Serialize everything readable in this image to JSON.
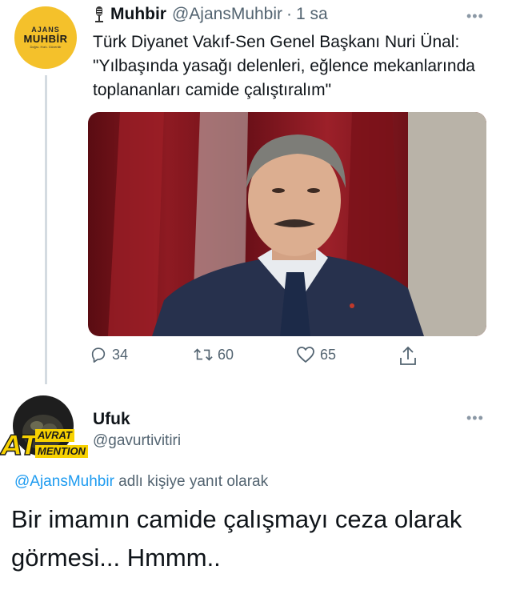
{
  "tweet1": {
    "avatar_text": {
      "line1": "AJANS",
      "line2": "MUHBİR",
      "line3": "Doğru. Hızlı. Güvenilir"
    },
    "author_name": "Muhbir",
    "handle": "@AjansMuhbir",
    "separator": "·",
    "time": "1 sa",
    "text": "Türk Diyanet Vakıf-Sen Genel Başkanı Nuri Ünal: \"Yılbaşında yasağı delenleri, eğlence mekanlarında toplananları camide çalıştıralım\"",
    "more_glyph": "•••",
    "actions": {
      "replies": "34",
      "retweets": "60",
      "likes": "65"
    }
  },
  "tweet2": {
    "avatar_text": {
      "line1": "AT",
      "line2": "AVRAT",
      "line3": "MENTION"
    },
    "author_name": "Ufuk",
    "handle": "@gavurtivitiri",
    "more_glyph": "•••",
    "reply_to_handle": "@AjansMuhbir",
    "reply_suffix": " adlı kişiye yanıt olarak",
    "text": "Bir imamın camide çalışmayı ceza olarak görmesi... Hmmm.."
  },
  "colors": {
    "text": "#0f1419",
    "secondary": "#536471",
    "link": "#1d9bf0",
    "thread_line": "#d4dbe1",
    "avatar_yellow": "#f4c12b"
  }
}
